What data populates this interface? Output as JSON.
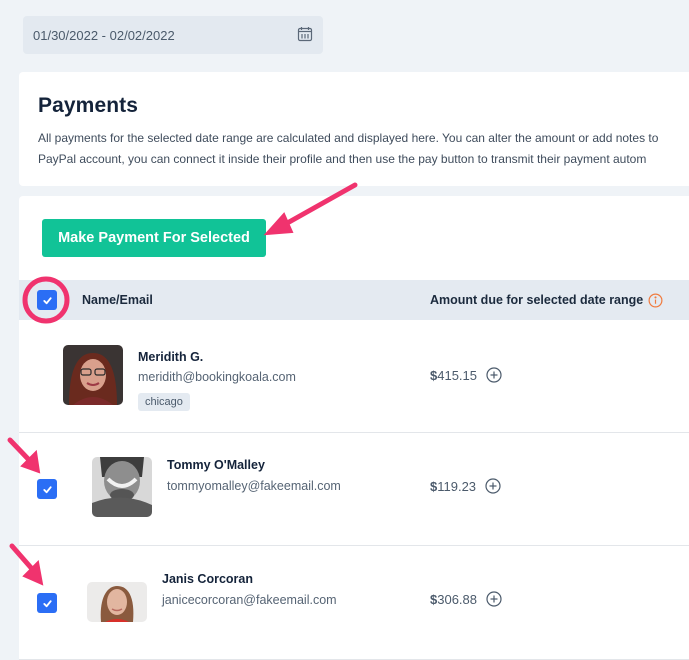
{
  "date_range": {
    "value": "01/30/2022 - 02/02/2022",
    "icon": "calendar-icon"
  },
  "header": {
    "title": "Payments",
    "description_line1": "All payments for the selected date range are calculated and displayed here. You can alter the amount or add notes to",
    "description_line2": "PayPal account, you can connect it inside their profile and then use the pay button to transmit their payment autom"
  },
  "toolbar": {
    "pay_selected_label": "Make Payment For Selected"
  },
  "table": {
    "select_all_checked": true,
    "columns": {
      "name_email": "Name/Email",
      "amount_due": "Amount due for selected date range"
    },
    "rows": [
      {
        "name": "Meridith G.",
        "email": "meridith@bookingkoala.com",
        "tag": "chicago",
        "amount_symbol": "$",
        "amount_value": "415.15",
        "checkbox_visible": false
      },
      {
        "name": "Tommy O'Malley",
        "email": "tommyomalley@fakeemail.com",
        "amount_symbol": "$",
        "amount_value": "119.23",
        "checkbox_visible": true,
        "checked": true
      },
      {
        "name": "Janis Corcoran",
        "email": "janicecorcoran@fakeemail.com",
        "amount_symbol": "$",
        "amount_value": "306.88",
        "checkbox_visible": true,
        "checked": true
      }
    ]
  },
  "colors": {
    "primary_button": "#11c397",
    "checkbox": "#2b6ef5",
    "info_icon": "#f07b3f",
    "annotation": "#f0336e"
  }
}
